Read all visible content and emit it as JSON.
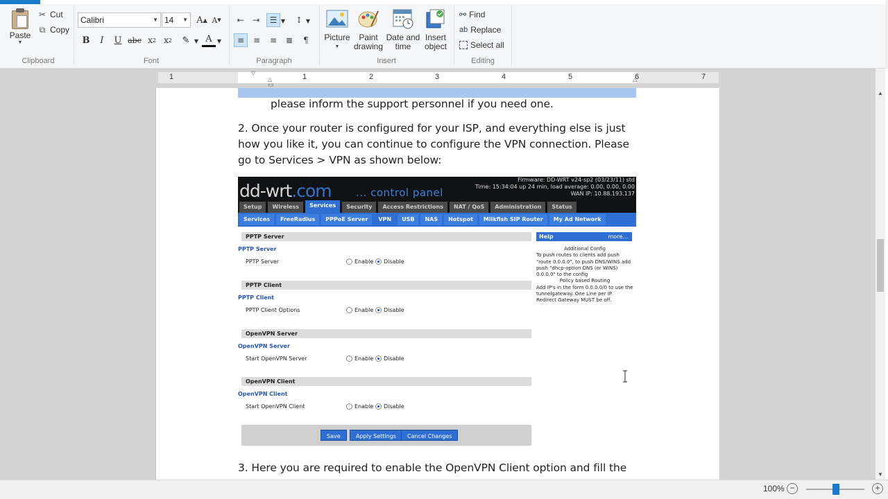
{
  "ribbon": {
    "clipboard": {
      "paste_label": "Paste",
      "cut_label": "Cut",
      "copy_label": "Copy",
      "group_label": "Clipboard"
    },
    "font": {
      "family": "Calibri",
      "size": "14",
      "group_label": "Font"
    },
    "paragraph": {
      "group_label": "Paragraph"
    },
    "insert": {
      "picture_label": "Picture",
      "paint_label": "Paint\ndrawing",
      "paint_line1": "Paint",
      "paint_line2": "drawing",
      "datetime_line1": "Date and",
      "datetime_line2": "time",
      "object_line1": "Insert",
      "object_line2": "object",
      "group_label": "Insert"
    },
    "editing": {
      "find_label": "Find",
      "replace_label": "Replace",
      "select_all_label": "Select all",
      "group_label": "Editing"
    }
  },
  "ruler": {
    "numbers": [
      "1",
      "1",
      "2",
      "3",
      "4",
      "5",
      "6",
      "7"
    ]
  },
  "document": {
    "line_top": "please inform the support personnel if you need one.",
    "para2": "2. Once your router is configured for your ISP, and everything else is just how you like it, you can continue to configure the VPN connection. Please go to Services > VPN as shown below:",
    "para3": "3. Here you are required to enable the OpenVPN Client option and fill the"
  },
  "ddwrt": {
    "logo_main": "dd-wrt",
    "logo_domain": ".com",
    "control_panel": "... control panel",
    "firmware": "Firmware: DD-WRT v24-sp2 (03/23/11) std",
    "time": "Time: 15:34:04 up 24 min, load average: 0.00, 0.00, 0.00",
    "wan_ip": "WAN IP: 10.88.193.137",
    "tabs": [
      "Setup",
      "Wireless",
      "Services",
      "Security",
      "Access Restrictions",
      "NAT / QoS",
      "Administration",
      "Status"
    ],
    "subtabs": [
      "Services",
      "FreeRadius",
      "PPPoE Server",
      "VPN",
      "USB",
      "NAS",
      "Hotspot",
      "Milkfish SIP Router",
      "My Ad Network"
    ],
    "sections": [
      {
        "head": "PPTP Server",
        "legend": "PPTP Server",
        "label": "PPTP Server"
      },
      {
        "head": "PPTP Client",
        "legend": "PPTP Client",
        "label": "PPTP Client Options"
      },
      {
        "head": "OpenVPN Server",
        "legend": "OpenVPN Server",
        "label": "Start OpenVPN Server"
      },
      {
        "head": "OpenVPN Client",
        "legend": "OpenVPN Client",
        "label": "Start OpenVPN Client"
      }
    ],
    "enable_label": "Enable",
    "disable_label": "Disable",
    "help": {
      "title": "Help",
      "more": "more...",
      "heading1": "Additional Config",
      "body1": "To push routes to clients add push \"route 0.0.0.0\", to push DNS/WINS add push \"dhcp-option DNS (or WINS) 0.0.0.0\" to the config",
      "heading2": "Policy based Routing",
      "body2": "Add IP's in the form 0.0.0.0/0 to use the tunnelgateway. One Line per IP. Redirect Gateway MUST be off."
    },
    "buttons": {
      "save": "Save",
      "apply": "Apply Settings",
      "cancel": "Cancel Changes"
    }
  },
  "status": {
    "zoom": "100%"
  },
  "colors": {
    "accent": "#1979ca",
    "ddwrt_blue": "#2f6fd3",
    "highlight": "#a8c7f0"
  }
}
